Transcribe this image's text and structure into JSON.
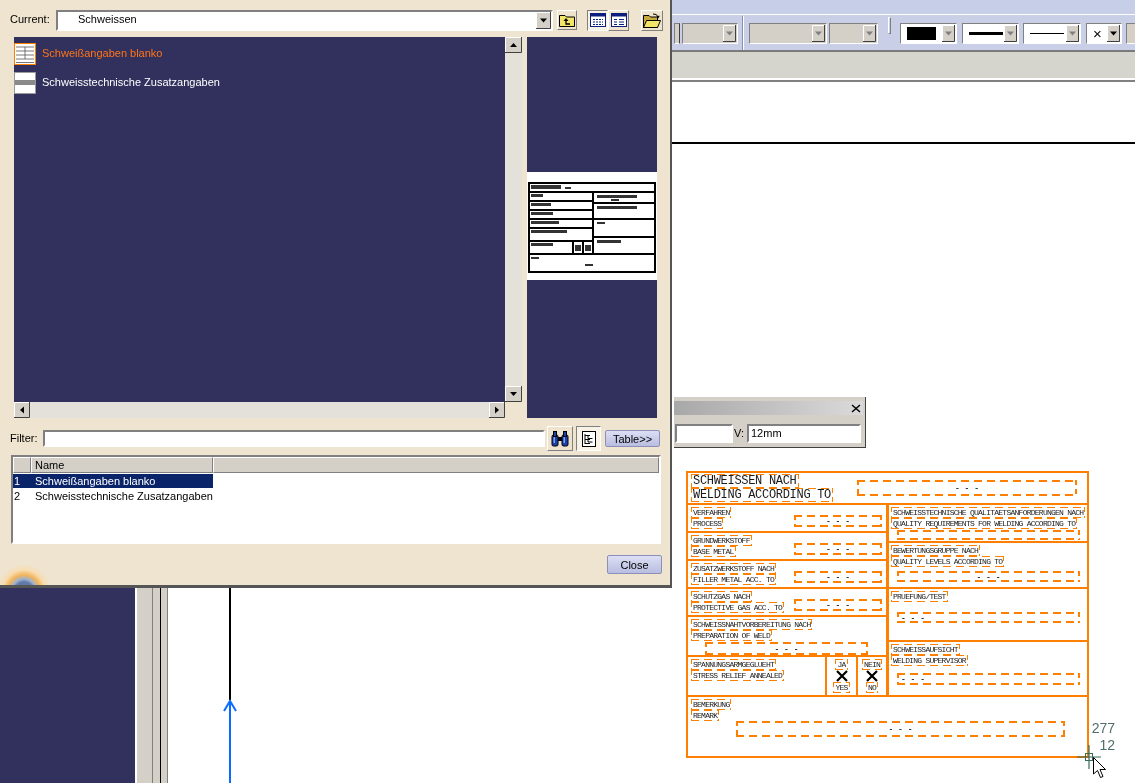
{
  "dialog": {
    "current_label": "Current:",
    "current_value": "Schweissen",
    "view_modes": [
      {
        "kind": "details",
        "selected": true
      },
      {
        "kind": "list",
        "selected": false
      }
    ],
    "catalog_items": [
      {
        "kind": "table",
        "label": "Schweißangaben blanko",
        "selected": true
      },
      {
        "kind": "strip",
        "label": "Schweisstechnische Zusatzangaben",
        "selected": false
      }
    ],
    "filter_label": "Filter:",
    "tree_toggle": {
      "on": true
    },
    "table_button": "Table>>",
    "table": {
      "columns": [
        "Name"
      ],
      "rows": [
        {
          "number": "1",
          "name": "Schweißangaben blanko",
          "selected": true
        },
        {
          "number": "2",
          "name": "Schweisstechnische Zusatzangaben",
          "selected": false
        }
      ]
    },
    "close_button": "Close"
  },
  "toolbar": {
    "dropdowns": [
      {
        "kind": "blank",
        "disabled": true
      },
      {
        "kind": "blank",
        "disabled": true
      },
      {
        "kind": "blank",
        "disabled": true
      },
      {
        "kind": "color",
        "color": "#000000",
        "disabled": true
      },
      {
        "kind": "thickness",
        "disabled": true
      },
      {
        "kind": "linetype",
        "disabled": true
      },
      {
        "kind": "symbol",
        "symbol": "×",
        "disabled": false
      }
    ]
  },
  "tool_panel": {
    "label": "V:",
    "value": "12mm"
  },
  "title_block": {
    "header": {
      "kind": "inline",
      "lines": [
        "SCHWEISSEN NACH",
        "WELDING ACCORDING TO"
      ],
      "field": {
        "kind": "center",
        "text": "- - -"
      }
    },
    "left_cells": [
      {
        "kind": "inline",
        "lines": [
          "VERFAHREN",
          "PROCESS"
        ],
        "field": {
          "kind": "center",
          "text": "- - -"
        }
      },
      {
        "kind": "inline",
        "lines": [
          "GRUNDWERKSTOFF",
          "BASE METAL"
        ],
        "field": {
          "kind": "center",
          "text": "- - -"
        }
      },
      {
        "kind": "inline",
        "lines": [
          "ZUSATZWERKSTOFF NACH",
          "FILLER METAL ACC. TO"
        ],
        "field": {
          "kind": "center",
          "text": "- - -"
        }
      },
      {
        "kind": "inline",
        "lines": [
          "SCHUTZGAS NACH",
          "PROTECTIVE GAS ACC. TO"
        ],
        "field": {
          "kind": "center",
          "text": "- - -"
        }
      },
      {
        "kind": "stacked",
        "lines": [
          "SCHWEISSNAHTVORBEREITUNG NACH",
          "PREPARATION OF WELD"
        ],
        "field": {
          "kind": "center",
          "text": "- - -"
        }
      },
      {
        "kind": "options",
        "lines": [
          "SPANNUNGSARMGEGLUEHT",
          "STRESS RELIEF ANNEALED"
        ],
        "options": [
          {
            "lines": [
              "JA",
              "YES"
            ],
            "checked": true
          },
          {
            "lines": [
              "NEIN",
              "NO"
            ],
            "checked": true
          }
        ]
      }
    ],
    "right_cells": [
      {
        "kind": "stacked",
        "lines": [
          "SCHWEISSTECHNISCHE QUALITAETSANFORDERUNGEN NACH",
          "QUALITY REQUIREMENTS FOR WELDING ACCORDING TO"
        ],
        "field": {
          "kind": "blank"
        }
      },
      {
        "kind": "stacked",
        "lines": [
          "BEWERTUNGSGRUPPE NACH",
          "QUALITY LEVELS ACCORDING TO"
        ],
        "field": {
          "kind": "center",
          "text": "- - -"
        }
      },
      {
        "kind": "stacked",
        "lines": [
          "PRUEFUNG/TEST"
        ],
        "field": {
          "kind": "left",
          "text": "- - -"
        }
      },
      {
        "kind": "stacked",
        "lines": [
          "SCHWEISSAUFSICHT",
          "WELDING SUPERVISOR"
        ],
        "field": {
          "kind": "left",
          "text": "- - -"
        }
      }
    ],
    "remark": {
      "kind": "stacked",
      "lines": [
        "BEMERKUNG",
        "REMARK"
      ],
      "field": {
        "kind": "center",
        "text": "- - -"
      }
    }
  },
  "cursor_readout": [
    "277",
    "12"
  ]
}
